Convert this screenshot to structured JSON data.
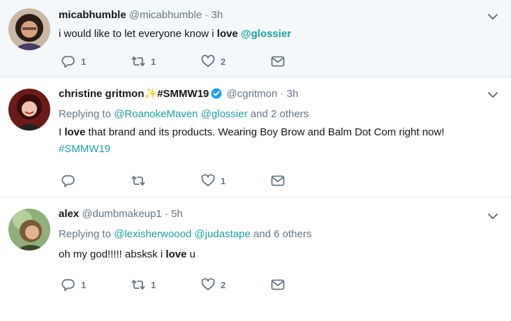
{
  "colors": {
    "link": "#1da1a1",
    "muted": "#657786",
    "highlight_bg": "#f5f8fa",
    "verified": "#1da1f2"
  },
  "tweets": [
    {
      "name": "micabhumble",
      "handle": "@micabhumble",
      "dot": "·",
      "time": "3h",
      "text_before": "i would like to let everyone know i ",
      "text_bold": "love",
      "text_space": " ",
      "text_link": "@glossier",
      "reply_count": "1",
      "retweet_count": "1",
      "like_count": "2"
    },
    {
      "name": "christine gritmon",
      "emoji": "✨",
      "tag_name": "#SMMW19",
      "verified": true,
      "handle": "@cgritmon",
      "dot": "·",
      "time": "3h",
      "replying_prefix": "Replying to ",
      "replying_user1": "@RoanokeMaven",
      "replying_user2": "@glossier",
      "replying_suffix": " and 2 others",
      "text_before": "I ",
      "text_bold": "love",
      "text_after": " that brand and its products. Wearing Boy Brow and Balm Dot Com right now! ",
      "text_link": "#SMMW19",
      "reply_count": "",
      "retweet_count": "",
      "like_count": "1"
    },
    {
      "name": "alex",
      "handle": "@dumbmakeup1",
      "dot": "·",
      "time": "5h",
      "replying_prefix": "Replying to ",
      "replying_user1": "@lexisherwoood",
      "replying_user2": "@judastape",
      "replying_suffix": " and 6 others",
      "text_before": "oh my god!!!!! absksk i ",
      "text_bold": "love",
      "text_after": " u",
      "reply_count": "1",
      "retweet_count": "1",
      "like_count": "2"
    }
  ],
  "icons": {
    "reply": "reply-icon",
    "retweet": "retweet-icon",
    "like": "heart-icon",
    "dm": "envelope-icon",
    "more": "chevron-down-icon",
    "verified": "verified-badge-icon"
  }
}
